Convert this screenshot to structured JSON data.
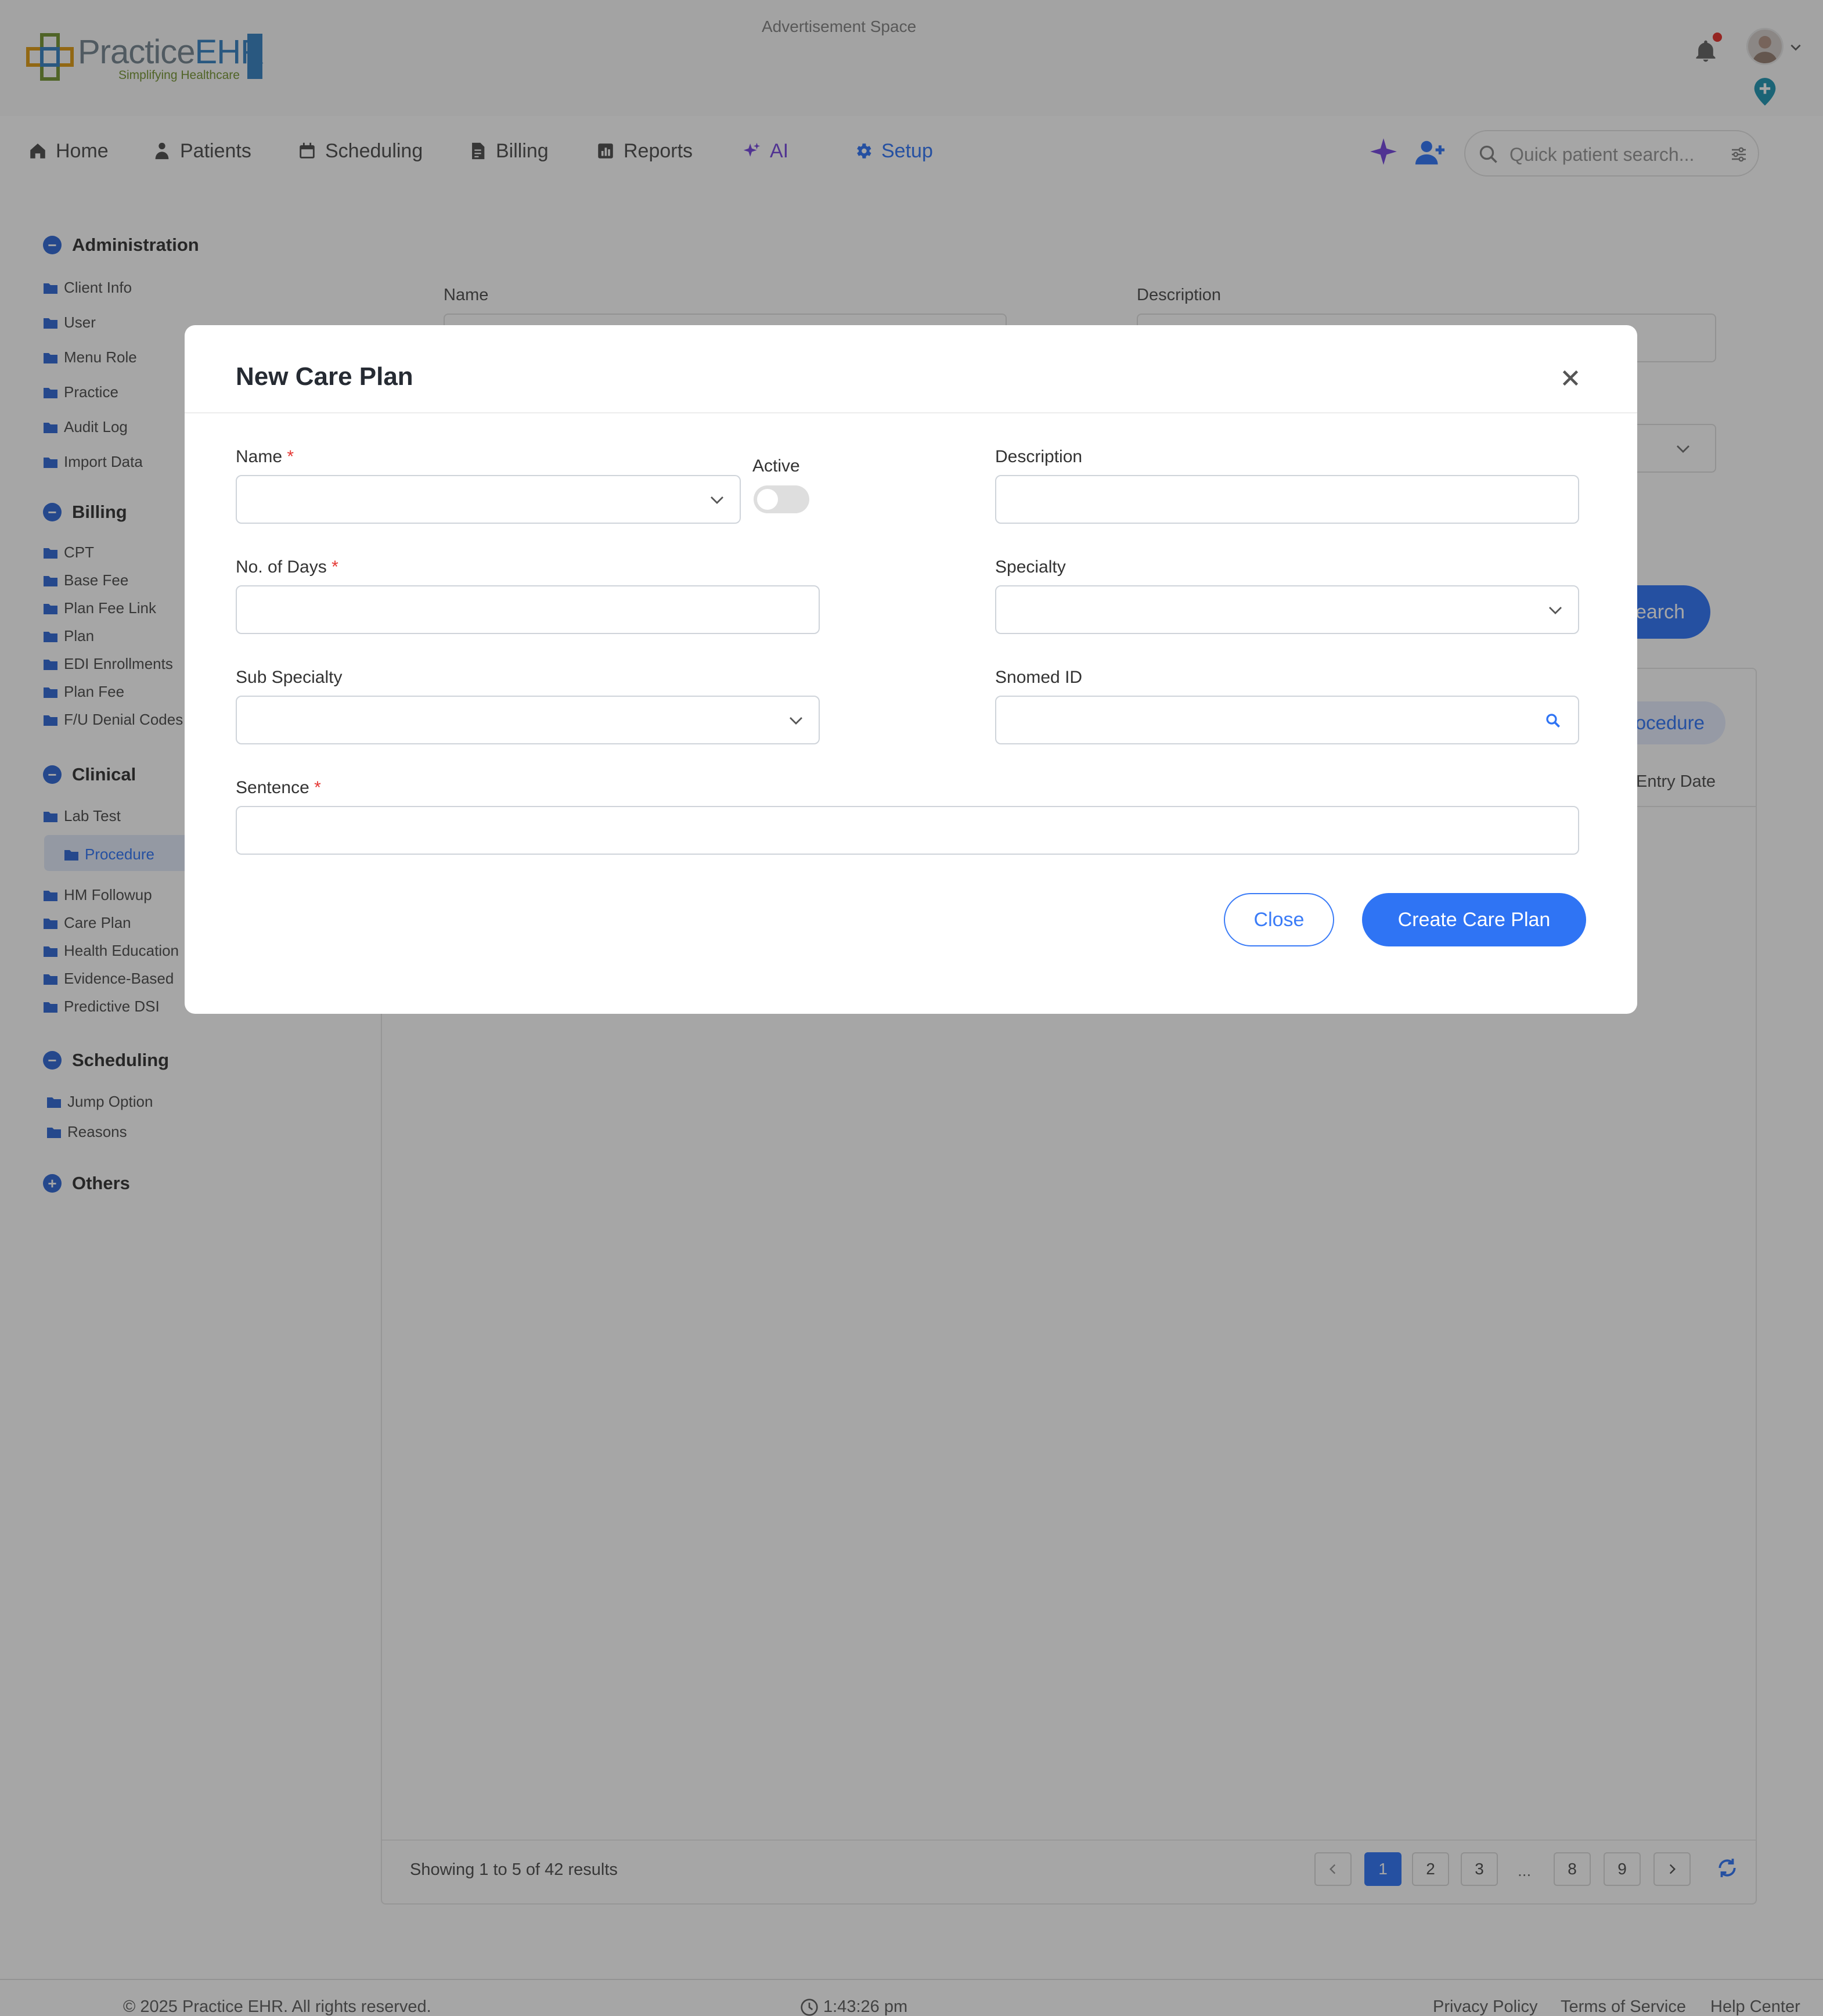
{
  "header": {
    "logo_brand": "PracticeEHR",
    "logo_tagline": "Simplifying Healthcare",
    "ad_space": "Advertisement Space"
  },
  "nav": {
    "items": [
      {
        "label": "Home",
        "icon": "home-icon"
      },
      {
        "label": "Patients",
        "icon": "patients-icon"
      },
      {
        "label": "Scheduling",
        "icon": "calendar-icon"
      },
      {
        "label": "Billing",
        "icon": "billing-icon"
      },
      {
        "label": "Reports",
        "icon": "reports-icon"
      },
      {
        "label": "AI",
        "icon": "sparkle-icon"
      },
      {
        "label": "Setup",
        "icon": "gear-icon"
      }
    ],
    "active": "Setup",
    "search_placeholder": "Quick patient search..."
  },
  "sidebar": {
    "administration": {
      "title": "Administration",
      "items": [
        "Client Info",
        "User",
        "Menu Role",
        "Practice",
        "Audit Log",
        "Import Data"
      ]
    },
    "billing": {
      "title": "Billing",
      "items": [
        "CPT",
        "Base Fee",
        "Plan Fee Link",
        "Plan",
        "EDI Enrollments",
        "Plan Fee",
        "F/U Denial Codes"
      ]
    },
    "clinical": {
      "title": "Clinical",
      "items": [
        "Lab Test",
        "Procedure",
        "HM Followup",
        "Care Plan",
        "Health Education",
        "Evidence-Based",
        "Predictive DSI"
      ]
    },
    "scheduling": {
      "title": "Scheduling",
      "items": [
        "Jump Option",
        "Reasons"
      ]
    },
    "others": {
      "title": "Others"
    },
    "active_item": "Procedure"
  },
  "background_page": {
    "name_label": "Name",
    "description_label": "Description",
    "search_button": "Search",
    "procedure_button": "Procedure",
    "entry_date_col": "Entry Date",
    "showing": "Showing 1 to 5 of 42 results",
    "pages": [
      "1",
      "2",
      "3",
      "...",
      "8",
      "9"
    ],
    "current_page": "1"
  },
  "modal": {
    "title": "New Care Plan",
    "fields": {
      "name": {
        "label": "Name",
        "value": ""
      },
      "active": {
        "label": "Active",
        "value": false
      },
      "description": {
        "label": "Description",
        "value": ""
      },
      "no_of_days": {
        "label": "No. of Days",
        "value": ""
      },
      "specialty": {
        "label": "Specialty",
        "value": ""
      },
      "sub_specialty": {
        "label": "Sub Specialty",
        "value": ""
      },
      "snomed_id": {
        "label": "Snomed ID",
        "value": ""
      },
      "sentence": {
        "label": "Sentence",
        "value": ""
      }
    },
    "required_mark": "*",
    "close_button": "Close",
    "create_button": "Create Care Plan"
  },
  "footer": {
    "copyright": "© 2025 Practice EHR. All rights reserved.",
    "time": "1:43:26 pm",
    "links": [
      "Privacy Policy",
      "Terms of Service",
      "Help Center"
    ]
  },
  "colors": {
    "accent": "#2f74f4",
    "required": "#e53935",
    "ai": "#7b4fe0"
  }
}
